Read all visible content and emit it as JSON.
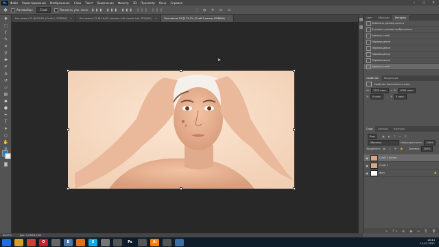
{
  "app": {
    "logo_text": "Ps"
  },
  "menu": [
    "Файл",
    "Редактирование",
    "Изображение",
    "Слои",
    "Текст",
    "Выделение",
    "Фильтр",
    "3D",
    "Просмотр",
    "Окно",
    "Справка"
  ],
  "window_controls": [
    "–",
    "▢",
    "✕"
  ],
  "options_bar": {
    "autoselect_label": "Автовыбор:",
    "autoselect_value": "Слой",
    "transform_label": "Показать упр. элем."
  },
  "tabs": [
    {
      "label": "Без имени-11 @ 83,3% (Слой 1, RGB/8#)",
      "active": false
    },
    {
      "label": "Без имени-12 @ 16,6% (woman with hands hair, RGB/8#)",
      "active": false
    },
    {
      "label": "Без имени-13 @ 72,7% (Слой 1 копия, RGB/8#)",
      "active": true
    }
  ],
  "right_panel": {
    "top_tabs": [
      "Цвет",
      "Образцы",
      "История"
    ],
    "history_items": [
      "Изменить размер холста",
      "Вставить размер изображения",
      "Удалить слой",
      "Перемещение",
      "Перемещение",
      "Перемещение",
      "Перемещение",
      "Удалить слой"
    ],
    "properties_tabs": [
      "Свойства",
      "Коррекция"
    ],
    "properties_title": "Свойства пиксельного слоя",
    "props": {
      "w_label": "Ш:",
      "w_value": "1920 пикс.",
      "h_label": "В:",
      "h_value": "1080 пикс.",
      "x_label": "X:",
      "x_value": "0 пикс.",
      "y_label": "Y:",
      "y_value": "0 пикс."
    },
    "layers_tabs": [
      "Слои",
      "Каналы",
      "Контуры"
    ],
    "layers_kind": "Вид",
    "blend_mode": "Обычные",
    "opacity_label": "Непрозрачность:",
    "opacity_value": "100%",
    "lock_label": "Закрепить:",
    "fill_label": "Заливка:",
    "fill_value": "100%",
    "layers": [
      {
        "name": "Слой 1 копия",
        "selected": true,
        "thumb_color": "#d8a789"
      },
      {
        "name": "Слой 1",
        "selected": false,
        "thumb_color": "#d8a789"
      },
      {
        "name": "Фон",
        "selected": false,
        "thumb_color": "#ffffff"
      }
    ]
  },
  "status": {
    "zoom": "66,67%",
    "doc": "Док: 5,93М/12,5М"
  },
  "taskbar": {
    "items": [
      {
        "icon": "start-icon",
        "label": "",
        "color": "#1e6fd9"
      },
      {
        "icon": "folder-icon",
        "label": "",
        "color": "#d9a020"
      },
      {
        "icon": "chrome-icon",
        "label": "",
        "color": "#d04030"
      },
      {
        "icon": "opera-icon",
        "label": "O",
        "color": "#cc1b2b"
      },
      {
        "icon": "media-icon",
        "label": "",
        "color": "#666666"
      },
      {
        "icon": "vk-icon",
        "label": "В",
        "color": "#4a76a8"
      },
      {
        "icon": "fox-icon",
        "label": "",
        "color": "#e07020"
      },
      {
        "icon": "skype-icon",
        "label": "S",
        "color": "#00aff0"
      },
      {
        "icon": "winamp-icon",
        "label": "",
        "color": "#777777"
      },
      {
        "icon": "mail-icon",
        "label": "",
        "color": "#555555"
      },
      {
        "icon": "photoshop-icon",
        "label": "Ps",
        "color": "#0b1b2d"
      },
      {
        "icon": "app-icon",
        "label": "",
        "color": "#555555"
      },
      {
        "icon": "illustrator-icon",
        "label": "Ai",
        "color": "#ff7c00"
      },
      {
        "icon": "app2-icon",
        "label": "",
        "color": "#555555"
      },
      {
        "icon": "explorer-icon",
        "label": "",
        "color": "#3a6ea5"
      }
    ],
    "time": "18:44",
    "date": "14.01.2021"
  }
}
